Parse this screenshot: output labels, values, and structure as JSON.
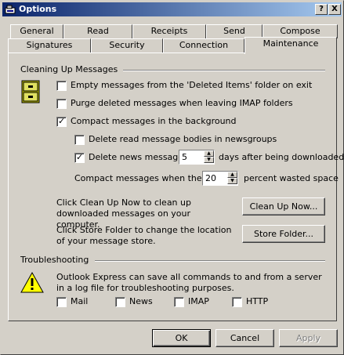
{
  "window": {
    "title": "Options",
    "help_button": "?",
    "close_button": "X"
  },
  "tabs_back": [
    "General",
    "Read",
    "Receipts",
    "Send",
    "Compose"
  ],
  "tabs_front": [
    "Signatures",
    "Security",
    "Connection",
    "Maintenance"
  ],
  "active_tab": "Maintenance",
  "cleanup": {
    "group_label": "Cleaning Up Messages",
    "empty_deleted": {
      "label": "Empty messages from the 'Deleted Items' folder on exit",
      "checked": false
    },
    "purge_imap": {
      "label": "Purge deleted messages when leaving IMAP folders",
      "checked": false
    },
    "compact_bg": {
      "label": "Compact messages in the background",
      "checked": true
    },
    "delete_read_bodies": {
      "label": "Delete read message bodies in newsgroups",
      "checked": false
    },
    "delete_news": {
      "label": "Delete news messages",
      "checked": true,
      "days": "5",
      "suffix": "days after being downloaded"
    },
    "compact_when": {
      "prefix": "Compact messages when there is",
      "percent": "20",
      "suffix": "percent wasted space"
    },
    "cleanup_text": "Click Clean Up Now to clean up downloaded messages on your computer.",
    "cleanup_button": "Clean Up Now...",
    "store_text": "Click Store Folder to change the location of your message store.",
    "store_button": "Store Folder..."
  },
  "troubleshooting": {
    "group_label": "Troubleshooting",
    "text": "Outlook Express can save all commands to and from a server in a log file for troubleshooting purposes.",
    "mail": "Mail",
    "news": "News",
    "imap": "IMAP",
    "http": "HTTP"
  },
  "footer": {
    "ok": "OK",
    "cancel": "Cancel",
    "apply": "Apply"
  }
}
